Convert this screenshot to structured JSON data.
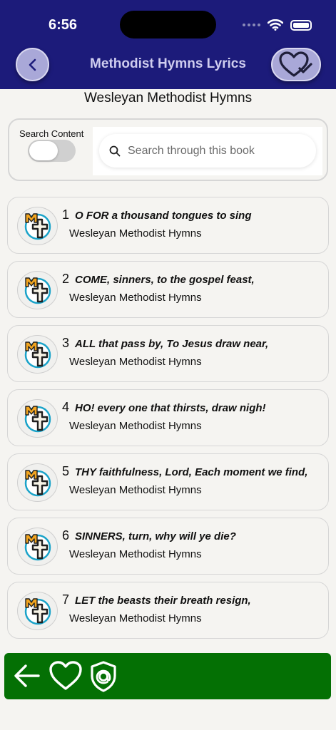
{
  "status": {
    "time": "6:56"
  },
  "header": {
    "title": "Methodist Hymns Lyrics"
  },
  "book": {
    "title": "Wesleyan Methodist Hymns"
  },
  "search": {
    "toggle_label": "Search Content",
    "placeholder": "Search through this book",
    "value": ""
  },
  "hymns": [
    {
      "number": "1",
      "first_line": "O FOR a thousand tongues to sing",
      "book": "Wesleyan Methodist Hymns"
    },
    {
      "number": "2",
      "first_line": "COME, sinners, to the gospel feast,",
      "book": "Wesleyan Methodist Hymns"
    },
    {
      "number": "3",
      "first_line": "ALL that pass by, To Jesus draw near,",
      "book": "Wesleyan Methodist Hymns"
    },
    {
      "number": "4",
      "first_line": "HO! every one that thirsts, draw nigh!",
      "book": "Wesleyan Methodist Hymns"
    },
    {
      "number": "5",
      "first_line": "THY faithfulness, Lord, Each moment we find,",
      "book": "Wesleyan Methodist Hymns"
    },
    {
      "number": "6",
      "first_line": "SINNERS, turn, why will ye die?",
      "book": "Wesleyan Methodist Hymns"
    },
    {
      "number": "7",
      "first_line": "LET the beasts their breath resign,",
      "book": "Wesleyan Methodist Hymns"
    }
  ],
  "icons": {
    "back": "chevron-left-icon",
    "favorites": "heart-check-icon",
    "search": "search-icon",
    "hymn": "methodist-cross-icon",
    "nav_back": "arrow-left-icon",
    "nav_favorite": "heart-icon",
    "nav_privacy": "shield-at-icon"
  },
  "colors": {
    "header": "#1c1b7a",
    "bottom_bar": "#047004",
    "accent_button": "#a9a8d8",
    "cross_outline": "#1aa3c9",
    "letter_m": "#f2a51f"
  }
}
